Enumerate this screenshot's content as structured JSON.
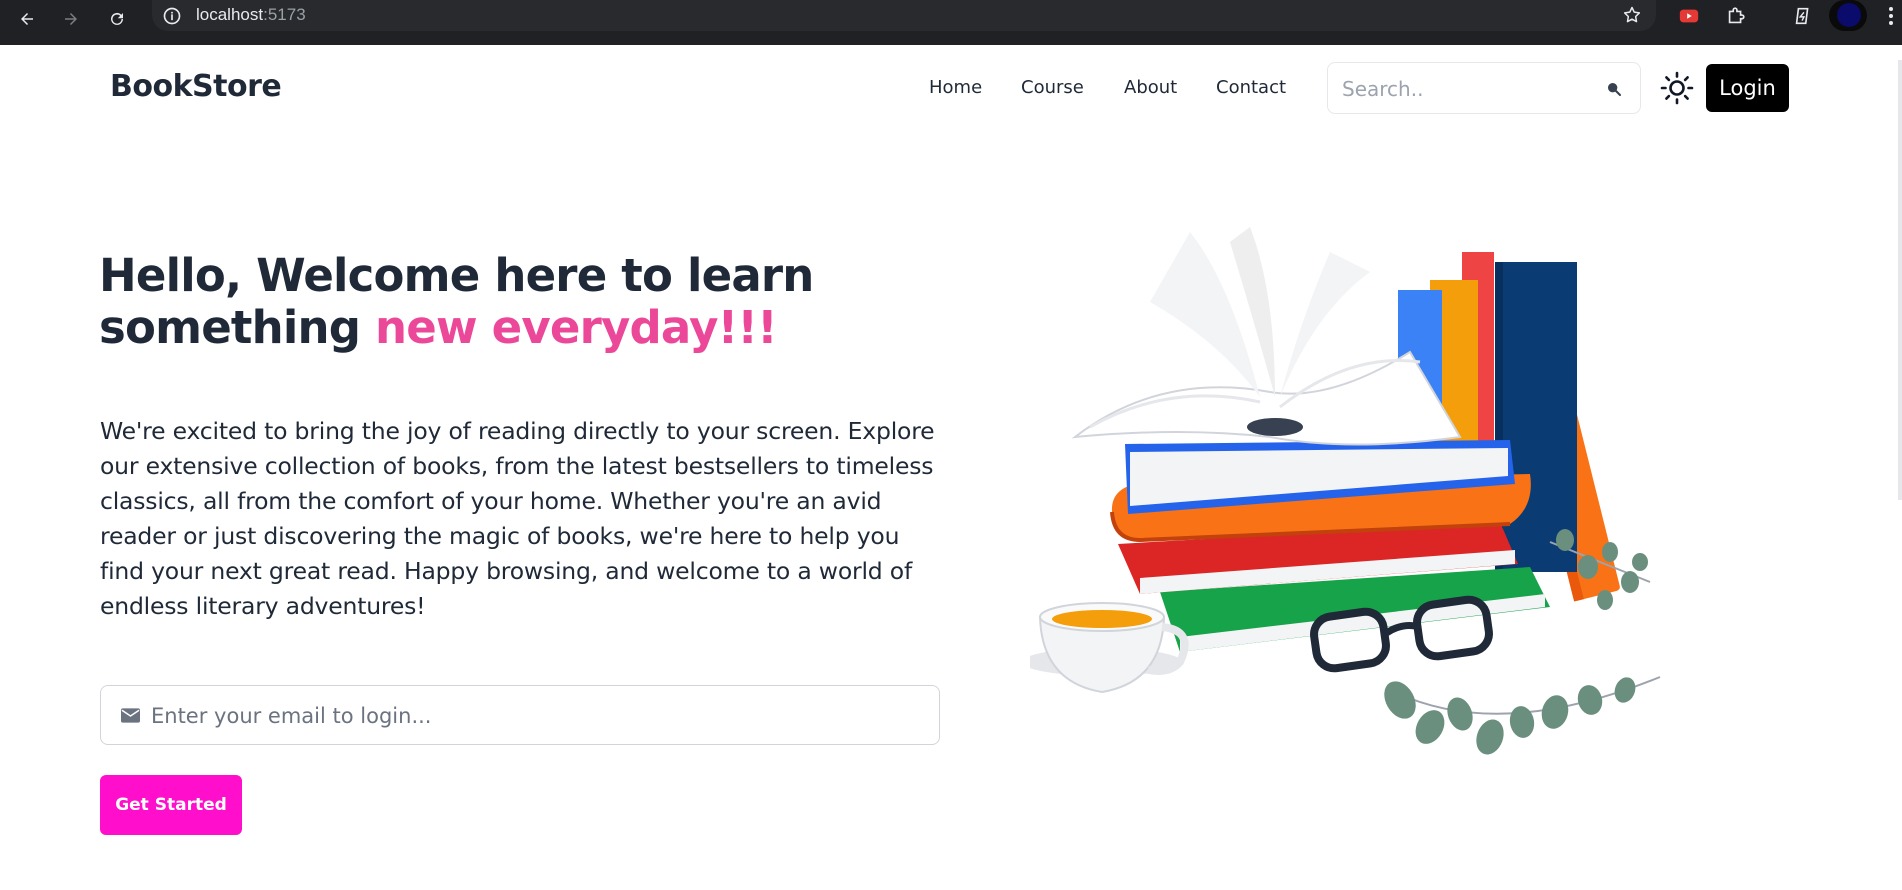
{
  "browser": {
    "url_host": "localhost",
    "url_port": ":5173",
    "icons": [
      "back-icon",
      "forward-icon",
      "reload-icon",
      "site-info-icon",
      "bookmark-star-icon",
      "youtube-extension-icon",
      "extensions-puzzle-icon",
      "extension-icon",
      "profile-avatar",
      "menu-kebab-icon"
    ]
  },
  "header": {
    "brand": "BookStore",
    "nav": [
      "Home",
      "Course",
      "About",
      "Contact"
    ],
    "search_placeholder": "Search..",
    "login_label": "Login"
  },
  "hero": {
    "title_line1": "Hello, Welcome here to learn",
    "title_line2_plain": "something",
    "title_line2_accent": "new everyday!!!",
    "description": "We're excited to bring the joy of reading directly to your screen. Explore our extensive collection of books, from the latest bestsellers to timeless classics, all from the comfort of your home. Whether you're an avid reader or just discovering the magic of books, we're here to help you find your next great read. Happy browsing, and welcome to a world of endless literary adventures!",
    "email_placeholder": "Enter your email to login...",
    "cta_label": "Get Started"
  },
  "colors": {
    "accent_pink": "#ec4899",
    "cta_magenta": "#ff0fcb",
    "text_dark": "#1f2937",
    "login_bg": "#000000"
  }
}
